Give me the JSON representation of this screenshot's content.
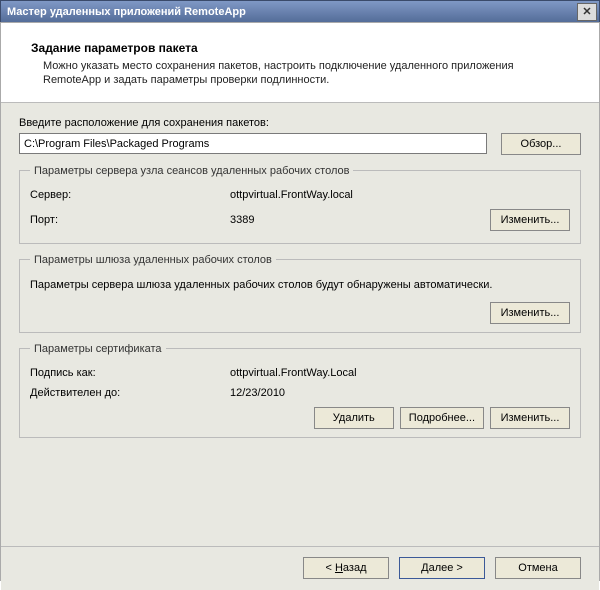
{
  "window": {
    "title": "Мастер удаленных приложений RemoteApp",
    "close_glyph": "✕"
  },
  "header": {
    "title": "Задание параметров пакета",
    "desc": "Можно указать место сохранения пакетов, настроить подключение удаленного приложения RemoteApp и задать параметры проверки подлинности."
  },
  "location": {
    "label": "Введите расположение для сохранения пакетов:",
    "path": "C:\\Program Files\\Packaged Programs",
    "browse": "Обзор..."
  },
  "server_group": {
    "legend": "Параметры сервера узла сеансов удаленных рабочих столов",
    "server_label": "Сервер:",
    "server_value": "ottpvirtual.FrontWay.local",
    "port_label": "Порт:",
    "port_value": "3389",
    "change": "Изменить..."
  },
  "gateway_group": {
    "legend": "Параметры шлюза удаленных рабочих столов",
    "note": "Параметры сервера шлюза удаленных рабочих столов будут обнаружены автоматически.",
    "change": "Изменить..."
  },
  "cert_group": {
    "legend": "Параметры сертификата",
    "signed_label": "Подпись как:",
    "signed_value": "ottpvirtual.FrontWay.Local",
    "valid_label": "Действителен до:",
    "valid_value": "12/23/2010",
    "delete": "Удалить",
    "details": "Подробнее...",
    "change": "Изменить..."
  },
  "footer": {
    "back_pre": "< ",
    "back_u": "Н",
    "back_post": "азад",
    "next_u": "Д",
    "next_post": "алее >",
    "cancel": "Отмена"
  }
}
